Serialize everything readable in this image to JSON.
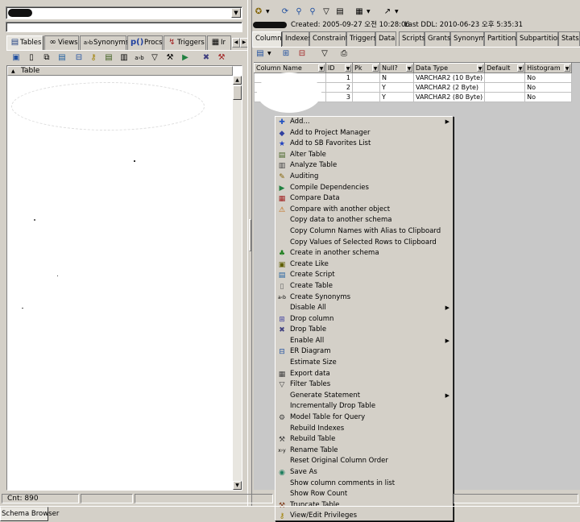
{
  "left_panel": {
    "schema_combo_value": "",
    "filter_value": "",
    "tabs": [
      {
        "label": "Tables",
        "icon": "table-icon"
      },
      {
        "label": "Views",
        "icon": "glasses-icon"
      },
      {
        "label": "Synonyms",
        "icon": "synonym-icon"
      },
      {
        "label": "Procs",
        "icon": "proc-icon"
      },
      {
        "label": "Triggers",
        "icon": "trigger-icon"
      },
      {
        "label": "Ir",
        "icon": "index-icon"
      }
    ],
    "list_header": "Table",
    "status_count": "Cnt: 890",
    "bottom_tab": "Schema Browser"
  },
  "right_panel": {
    "info": {
      "created": "Created: 2005-09-27 오전 10:28:06",
      "last_ddl": "Last DDL: 2010-06-23 오후 5:35:31"
    },
    "tabs": [
      "Columns",
      "Indexes",
      "Constraints",
      "Triggers",
      "Data",
      "Scripts",
      "Grants",
      "Synonyms",
      "Partitions",
      "Subpartitions",
      "Stats/S"
    ],
    "grid": {
      "headers": [
        "Column Name",
        "ID",
        "Pk",
        "Null?",
        "Data Type",
        "Default",
        "Histogram"
      ],
      "rows": [
        {
          "name": "",
          "id": "1",
          "pk": "",
          "null": "N",
          "type": "VARCHAR2 (10 Byte)",
          "default": "",
          "hist": "No"
        },
        {
          "name": "",
          "id": "2",
          "pk": "",
          "null": "Y",
          "type": "VARCHAR2 (2 Byte)",
          "default": "",
          "hist": "No"
        },
        {
          "name": "",
          "id": "3",
          "pk": "",
          "null": "Y",
          "type": "VARCHAR2 (80 Byte)",
          "default": "",
          "hist": "No"
        }
      ]
    }
  },
  "context_menu": {
    "items": [
      {
        "label": "Add...",
        "icon": "plus-icon",
        "glyph": "✚",
        "color": "#2050c0",
        "submenu": true
      },
      {
        "label": "Add to Project Manager",
        "icon": "project-manager-icon",
        "glyph": "◆",
        "color": "#3040a0",
        "submenu": false
      },
      {
        "label": "Add to SB Favorites List",
        "icon": "star-icon",
        "glyph": "★",
        "color": "#2040c0",
        "submenu": false
      },
      {
        "label": "Alter Table",
        "icon": "alter-table-icon",
        "glyph": "▤",
        "color": "#406020",
        "submenu": false
      },
      {
        "label": "Analyze Table",
        "icon": "analyze-icon",
        "glyph": "▥",
        "color": "#404040",
        "submenu": false
      },
      {
        "label": "Auditing",
        "icon": "auditing-icon",
        "glyph": "✎",
        "color": "#806000",
        "submenu": false
      },
      {
        "label": "Compile Dependencies",
        "icon": "compile-icon",
        "glyph": "▶",
        "color": "#208040",
        "submenu": false
      },
      {
        "label": "Compare Data",
        "icon": "compare-data-icon",
        "glyph": "▦",
        "color": "#a02020",
        "submenu": false
      },
      {
        "label": "Compare with another object",
        "icon": "compare-object-icon",
        "glyph": "⚠",
        "color": "#c06000",
        "submenu": false
      },
      {
        "label": "Copy data to another schema",
        "icon": "",
        "glyph": "",
        "color": "#000000",
        "submenu": false
      },
      {
        "label": "Copy Column Names with Alias to Clipboard",
        "icon": "",
        "glyph": "",
        "color": "#000000",
        "submenu": false
      },
      {
        "label": "Copy Values of Selected Rows to Clipboard",
        "icon": "",
        "glyph": "",
        "color": "#000000",
        "submenu": false
      },
      {
        "label": "Create in another schema",
        "icon": "create-other-schema-icon",
        "glyph": "♣",
        "color": "#208020",
        "submenu": false
      },
      {
        "label": "Create Like",
        "icon": "create-like-icon",
        "glyph": "▣",
        "color": "#606000",
        "submenu": false
      },
      {
        "label": "Create Script",
        "icon": "create-script-icon",
        "glyph": "▤",
        "color": "#2060a0",
        "submenu": false
      },
      {
        "label": "Create Table",
        "icon": "create-table-icon",
        "glyph": "▯",
        "color": "#606060",
        "submenu": false
      },
      {
        "label": "Create Synonyms",
        "icon": "synonym-icon",
        "glyph": "a‹b",
        "color": "#000000",
        "submenu": false
      },
      {
        "label": "Disable All",
        "icon": "",
        "glyph": "",
        "color": "#000000",
        "submenu": true
      },
      {
        "label": "Drop column",
        "icon": "drop-column-icon",
        "glyph": "⊞",
        "color": "#4040a0",
        "submenu": false
      },
      {
        "label": "Drop Table",
        "icon": "drop-table-icon",
        "glyph": "✖",
        "color": "#404080",
        "submenu": false
      },
      {
        "label": "Enable All",
        "icon": "",
        "glyph": "",
        "color": "#000000",
        "submenu": true
      },
      {
        "label": "ER Diagram",
        "icon": "er-diagram-icon",
        "glyph": "⊟",
        "color": "#2050a0",
        "submenu": false
      },
      {
        "label": "Estimate Size",
        "icon": "",
        "glyph": "",
        "color": "#000000",
        "submenu": false
      },
      {
        "label": "Export data",
        "icon": "export-data-icon",
        "glyph": "▦",
        "color": "#404040",
        "submenu": false
      },
      {
        "label": "Filter Tables",
        "icon": "filter-icon",
        "glyph": "▽",
        "color": "#404040",
        "submenu": false
      },
      {
        "label": "Generate Statement",
        "icon": "",
        "glyph": "",
        "color": "#000000",
        "submenu": true
      },
      {
        "label": "Incrementally Drop Table",
        "icon": "",
        "glyph": "",
        "color": "#000000",
        "submenu": false
      },
      {
        "label": "Model Table for Query",
        "icon": "model-query-icon",
        "glyph": "⚙",
        "color": "#404040",
        "submenu": false
      },
      {
        "label": "Rebuild Indexes",
        "icon": "",
        "glyph": "",
        "color": "#000000",
        "submenu": false
      },
      {
        "label": "Rebuild Table",
        "icon": "rebuild-table-icon",
        "glyph": "⚒",
        "color": "#404040",
        "submenu": false
      },
      {
        "label": "Rename Table",
        "icon": "rename-icon",
        "glyph": "x›y",
        "color": "#000000",
        "submenu": false
      },
      {
        "label": "Reset Original Column Order",
        "icon": "",
        "glyph": "",
        "color": "#000000",
        "submenu": false
      },
      {
        "label": "Save As",
        "icon": "save-as-icon",
        "glyph": "◉",
        "color": "#208060",
        "submenu": false
      },
      {
        "label": "Show column comments in list",
        "icon": "",
        "glyph": "",
        "color": "#000000",
        "submenu": false
      },
      {
        "label": "Show Row Count",
        "icon": "",
        "glyph": "",
        "color": "#000000",
        "submenu": false
      },
      {
        "label": "Truncate Table",
        "icon": "truncate-icon",
        "glyph": "⚒",
        "color": "#804020",
        "submenu": false
      },
      {
        "label": "View/Edit Privileges",
        "icon": "key-icon",
        "glyph": "⚷",
        "color": "#a08000",
        "submenu": false
      }
    ]
  }
}
